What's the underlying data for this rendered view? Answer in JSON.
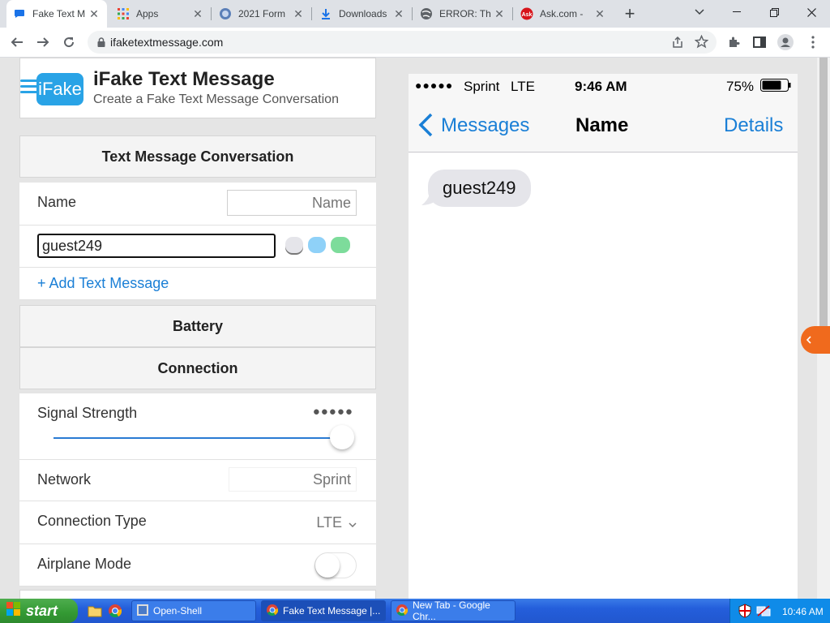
{
  "browser": {
    "tabs": [
      {
        "title": "Fake Text M",
        "icon": "chat-bubble-icon",
        "active": true
      },
      {
        "title": "Apps",
        "icon": "apps-grid-icon",
        "active": false
      },
      {
        "title": "2021 Form",
        "icon": "globe-seal-icon",
        "active": false
      },
      {
        "title": "Downloads",
        "icon": "download-icon",
        "active": false
      },
      {
        "title": "ERROR: Th",
        "icon": "globe-icon",
        "active": false
      },
      {
        "title": "Ask.com - ",
        "icon": "ask-icon",
        "active": false
      }
    ],
    "new_tab": "+",
    "url": "ifaketextmessage.com"
  },
  "app": {
    "brand_logo": "iFake",
    "brand_title": "iFake Text Message",
    "brand_subtitle": "Create a Fake Text Message Conversation",
    "section_conversation": "Text Message Conversation",
    "name_label": "Name",
    "name_placeholder": "Name",
    "message_value": "guest249",
    "add_message": "+ Add Text Message",
    "section_battery": "Battery",
    "section_connection": "Connection",
    "signal_label": "Signal Strength",
    "signal_dots": "●●●●●",
    "signal_level": 1.0,
    "network_label": "Network",
    "network_placeholder": "Sprint",
    "connection_type_label": "Connection Type",
    "connection_type_value": "LTE",
    "airplane_label": "Airplane Mode",
    "airplane_on": false,
    "bubble_colors": [
      "#e5e5ea",
      "#8fd1f8",
      "#7ddc9b"
    ]
  },
  "phone": {
    "signal": "●●●●●",
    "carrier": "Sprint",
    "network": "LTE",
    "time": "9:46 AM",
    "battery": "75%",
    "back_label": "Messages",
    "title": "Name",
    "details": "Details",
    "bubble_text": "guest249"
  },
  "taskbar": {
    "start": "start",
    "items": [
      "Open-Shell",
      "Fake Text Message |...",
      "New Tab - Google Chr..."
    ],
    "clock": "10:46 AM"
  }
}
